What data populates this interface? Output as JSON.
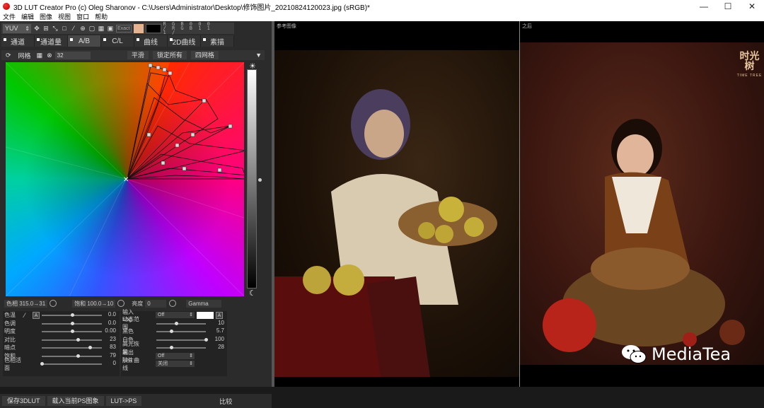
{
  "window": {
    "title": "3D LUT Creator Pro (c) Oleg Sharonov - C:\\Users\\Administrator\\Desktop\\修饰图片_20210824120023.jpg (sRGB)*",
    "min": "—",
    "max": "☐",
    "close": "✕"
  },
  "menu": [
    "文件",
    "编辑",
    "图像",
    "视图",
    "窗口",
    "帮助"
  ],
  "toolbar": {
    "mode": "YUV",
    "exact": "Exact",
    "rgb_readout": "R G B  0 0 0 / R G B  1 1 1 /"
  },
  "tabs": [
    "通道",
    "通道量",
    "A/B",
    "C/L",
    "曲线",
    "2D曲线",
    "素描"
  ],
  "subtoolbar": {
    "grid_label": "网格",
    "grid_value": "32",
    "btn_smooth": "平滑",
    "btn_lock": "锁定所有",
    "btn_reset": "四网格"
  },
  "status": {
    "hue": "色相 315.0→31",
    "sat": "饱和 100.0→10",
    "bright_label": "亮度",
    "bright_value": "0",
    "gamma": "Gamma"
  },
  "params_left": [
    {
      "label": "色温",
      "value": "0.0",
      "pos": 0.5
    },
    {
      "label": "色调",
      "value": "0.0",
      "pos": 0.5
    },
    {
      "label": "明度",
      "value": "0.00",
      "pos": 0.5
    },
    {
      "label": "对比",
      "value": "23",
      "pos": 0.6
    },
    {
      "label": "暗点",
      "value": "83",
      "pos": 0.8
    },
    {
      "label": "饱和",
      "value": "79",
      "pos": 0.6
    },
    {
      "label": "色相活面",
      "value": "0",
      "pos": 0.0
    }
  ],
  "params_left_a": "A",
  "params_right": [
    {
      "label": "输入Log",
      "dropdown": "Off",
      "value": ""
    },
    {
      "label": "动态范围",
      "value": "10",
      "pos": 0.4
    },
    {
      "label": "黑色",
      "value": "5.7",
      "pos": 0.3
    },
    {
      "label": "白色",
      "value": "100",
      "pos": 1.0
    },
    {
      "label": "高光恢复",
      "value": "28",
      "pos": 0.3
    },
    {
      "label": "输出Log",
      "dropdown": "Off",
      "value": ""
    },
    {
      "label": "胶片曲线",
      "dropdown": "关闭",
      "value": ""
    }
  ],
  "params_right_a": "A",
  "bottom": {
    "save": "保存3DLUT",
    "load": "载入当前PS图象",
    "lut_ps": "LUT->PS",
    "compare": "比较"
  },
  "panels": {
    "before": "参考图像",
    "after": "之后"
  },
  "logo": {
    "main": "时光树",
    "sub": "TIME TREE"
  },
  "watermark": "MediaTea",
  "colors": {
    "accent": "#e5b38f"
  }
}
